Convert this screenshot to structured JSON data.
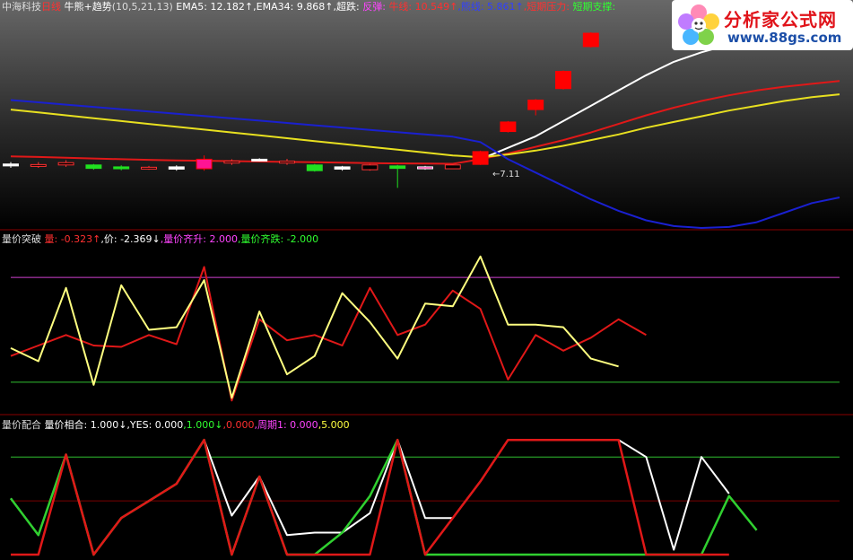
{
  "main_header": [
    {
      "text": "中海科技",
      "color": "#dddddd"
    },
    {
      "text": "日线",
      "color": "#ff3030"
    },
    {
      "text": " 牛熊+趋势",
      "color": "#ffffff"
    },
    {
      "text": "(10,5,21,13)",
      "color": "#dddddd"
    },
    {
      "text": "  EMA5: 12.182↑",
      "color": "#ffffff"
    },
    {
      "text": ",EMA34: 9.868↑",
      "color": "#ffffff"
    },
    {
      "text": ",超跌: ",
      "color": "#ffffff"
    },
    {
      "text": "反弹: ",
      "color": "#ff44ff"
    },
    {
      "text": "牛线: 10.549↑",
      "color": "#ff3030"
    },
    {
      "text": ",熊线: 5.861↑",
      "color": "#3040ff"
    },
    {
      "text": ",短期压力: ",
      "color": "#ff3030"
    },
    {
      "text": "短期支撑: ",
      "color": "#30ff30"
    }
  ],
  "vol_header": [
    {
      "text": "量价突破  ",
      "color": "#dddddd"
    },
    {
      "text": "量: -0.323↑",
      "color": "#ff3030"
    },
    {
      "text": ",价: -2.369↓",
      "color": "#ffffff"
    },
    {
      "text": ",量价齐升: 2.000",
      "color": "#ff44ff"
    },
    {
      "text": ",量价齐跌: -2.000",
      "color": "#30ff30"
    }
  ],
  "match_header": [
    {
      "text": "量价配合  ",
      "color": "#dddddd"
    },
    {
      "text": "量价相合: 1.000↓",
      "color": "#ffffff"
    },
    {
      "text": ",YES: 0.000",
      "color": "#ffffff"
    },
    {
      "text": ",1.000↓",
      "color": "#30ff30"
    },
    {
      "text": ",0.000",
      "color": "#ff3030"
    },
    {
      "text": ",周期1: 0.000",
      "color": "#ff44ff"
    },
    {
      "text": ",5.000",
      "color": "#ffff40"
    }
  ],
  "price_annotation": "←7.11",
  "watermark": {
    "title": "分析家公式网",
    "url": "www.88gs.com"
  },
  "chart_data": [
    {
      "type": "candlestick",
      "panel": "main",
      "ylim": [
        5,
        16
      ],
      "x_count": 31,
      "candles": [
        {
          "open": 8.25,
          "close": 8.35,
          "high": 8.45,
          "low": 8.15
        },
        {
          "open": 8.28,
          "close": 8.32,
          "high": 8.45,
          "low": 8.15
        },
        {
          "open": 8.3,
          "close": 8.42,
          "high": 8.55,
          "low": 8.2
        },
        {
          "open": 8.3,
          "close": 8.12,
          "high": 8.35,
          "low": 8.05
        },
        {
          "open": 8.2,
          "close": 8.1,
          "high": 8.28,
          "low": 8.02
        },
        {
          "open": 8.12,
          "close": 8.18,
          "high": 8.25,
          "low": 8.05
        },
        {
          "open": 8.08,
          "close": 8.2,
          "high": 8.28,
          "low": 8.0
        },
        {
          "open": 8.1,
          "close": 8.6,
          "high": 8.8,
          "low": 8.0
        },
        {
          "open": 8.4,
          "close": 8.5,
          "high": 8.6,
          "low": 8.3
        },
        {
          "open": 8.52,
          "close": 8.6,
          "high": 8.65,
          "low": 8.48
        },
        {
          "open": 8.4,
          "close": 8.5,
          "high": 8.62,
          "low": 8.3
        },
        {
          "open": 8.3,
          "close": 8.0,
          "high": 8.35,
          "low": 7.95
        },
        {
          "open": 8.08,
          "close": 8.2,
          "high": 8.25,
          "low": 8.0
        },
        {
          "open": 8.05,
          "close": 8.3,
          "high": 8.35,
          "low": 8.0
        },
        {
          "open": 8.25,
          "close": 8.12,
          "high": 8.3,
          "low": 7.1
        },
        {
          "open": 8.1,
          "close": 8.2,
          "high": 8.25,
          "low": 8.05
        },
        {
          "open": 8.1,
          "close": 8.3,
          "high": 8.32,
          "low": 8.08
        },
        {
          "open": 8.33,
          "close": 9.0,
          "high": 9.05,
          "low": 8.3
        },
        {
          "open": 10.05,
          "close": 10.55,
          "high": 10.6,
          "low": 10.0
        },
        {
          "open": 11.2,
          "close": 11.7,
          "high": 11.75,
          "low": 10.9
        },
        {
          "open": 12.3,
          "close": 13.2,
          "high": 13.25,
          "low": 12.25
        },
        {
          "open": 14.5,
          "close": 15.2,
          "high": 15.25,
          "low": 14.45
        }
      ],
      "series": [
        {
          "name": "EMA5",
          "color": "#ffffff",
          "values": [
            null,
            null,
            null,
            null,
            null,
            null,
            null,
            null,
            null,
            null,
            null,
            null,
            null,
            null,
            null,
            null,
            null,
            8.6,
            9.2,
            9.8,
            10.6,
            11.4,
            12.2,
            13.0,
            13.7,
            14.2,
            14.6,
            14.9,
            15.1,
            15.3,
            15.4
          ]
        },
        {
          "name": "牛线",
          "color": "#e01818",
          "values": [
            8.75,
            8.72,
            8.68,
            8.64,
            8.6,
            8.57,
            8.54,
            8.52,
            8.5,
            8.48,
            8.46,
            8.44,
            8.42,
            8.4,
            8.38,
            8.37,
            8.36,
            8.6,
            8.9,
            9.25,
            9.6,
            10.0,
            10.45,
            10.9,
            11.3,
            11.65,
            11.95,
            12.2,
            12.4,
            12.55,
            12.7
          ]
        },
        {
          "name": "EMA34",
          "color": "#e8e020",
          "values": [
            11.2,
            11.05,
            10.9,
            10.75,
            10.6,
            10.45,
            10.3,
            10.15,
            10.0,
            9.85,
            9.7,
            9.55,
            9.4,
            9.25,
            9.1,
            8.95,
            8.8,
            8.7,
            8.85,
            9.05,
            9.3,
            9.6,
            9.9,
            10.25,
            10.55,
            10.85,
            11.15,
            11.4,
            11.65,
            11.85,
            12.0
          ]
        },
        {
          "name": "熊线",
          "color": "#1a20d0",
          "values": [
            11.7,
            11.58,
            11.46,
            11.34,
            11.22,
            11.1,
            10.98,
            10.86,
            10.74,
            10.62,
            10.5,
            10.38,
            10.26,
            10.14,
            10.02,
            9.9,
            9.78,
            9.5,
            8.6,
            7.9,
            7.2,
            6.5,
            5.9,
            5.4,
            5.1,
            5.0,
            5.05,
            5.3,
            5.8,
            6.3,
            6.6
          ]
        }
      ]
    },
    {
      "type": "line",
      "panel": "vol",
      "title": "量价突破",
      "ylim": [
        -3,
        3
      ],
      "x_count": 31,
      "hlines": [
        {
          "value": 2.0,
          "color": "#d040d0"
        },
        {
          "value": -2.0,
          "color": "#30c030"
        }
      ],
      "series": [
        {
          "name": "量",
          "color": "#e01818",
          "values": [
            -1.0,
            -0.6,
            -0.2,
            -0.6,
            -0.65,
            -0.2,
            -0.55,
            2.4,
            -2.7,
            0.4,
            -0.4,
            -0.2,
            -0.6,
            1.6,
            -0.2,
            0.2,
            1.5,
            0.8,
            -1.9,
            -0.2,
            -0.8,
            -0.3,
            0.4,
            -0.2
          ]
        },
        {
          "name": "价",
          "color": "#ffff80",
          "values": [
            -0.7,
            -1.2,
            1.6,
            -2.1,
            1.7,
            0.0,
            0.1,
            1.9,
            -2.6,
            0.7,
            -1.7,
            -1.0,
            1.4,
            0.3,
            -1.1,
            1.0,
            0.9,
            2.8,
            0.2,
            0.2,
            0.1,
            -1.1,
            -1.4
          ]
        }
      ]
    },
    {
      "type": "line",
      "panel": "match",
      "title": "量价配合",
      "ylim": [
        0,
        5
      ],
      "x_count": 31,
      "hlines": [
        {
          "value": 4.0,
          "color": "#30c030"
        },
        {
          "value": 2.2,
          "color": "#7a0000"
        }
      ],
      "series": [
        {
          "name": "量价相合",
          "color": "#ffffff",
          "values": [
            2.3,
            0.8,
            4.1,
            0.0,
            1.5,
            2.2,
            2.9,
            4.7,
            1.6,
            3.2,
            0.8,
            0.9,
            0.9,
            1.7,
            4.7,
            1.5,
            1.5,
            3.0,
            4.7,
            4.7,
            4.7,
            4.7,
            4.7,
            4.0,
            0.2,
            4.0,
            2.5
          ]
        },
        {
          "name": "YES",
          "color": "#30d030",
          "values": [
            2.3,
            0.8,
            4.1,
            0.0,
            1.5,
            2.2,
            2.9,
            4.7,
            0.0,
            3.2,
            0.0,
            0.0,
            0.9,
            2.4,
            4.7,
            0.0,
            0.0,
            0.0,
            0.0,
            0.0,
            0.0,
            0.0,
            0.0,
            0.0,
            0.0,
            0.0,
            2.4,
            1.0
          ]
        },
        {
          "name": "0.000",
          "color": "#e01818",
          "values": [
            0.0,
            0.0,
            4.1,
            0.0,
            1.5,
            2.2,
            2.9,
            4.7,
            0.0,
            3.2,
            0.0,
            0.0,
            0.0,
            0.0,
            4.7,
            0.0,
            1.5,
            3.0,
            4.7,
            4.7,
            4.7,
            4.7,
            4.7,
            0.0,
            0.0,
            0.0,
            0.0
          ]
        }
      ]
    }
  ]
}
